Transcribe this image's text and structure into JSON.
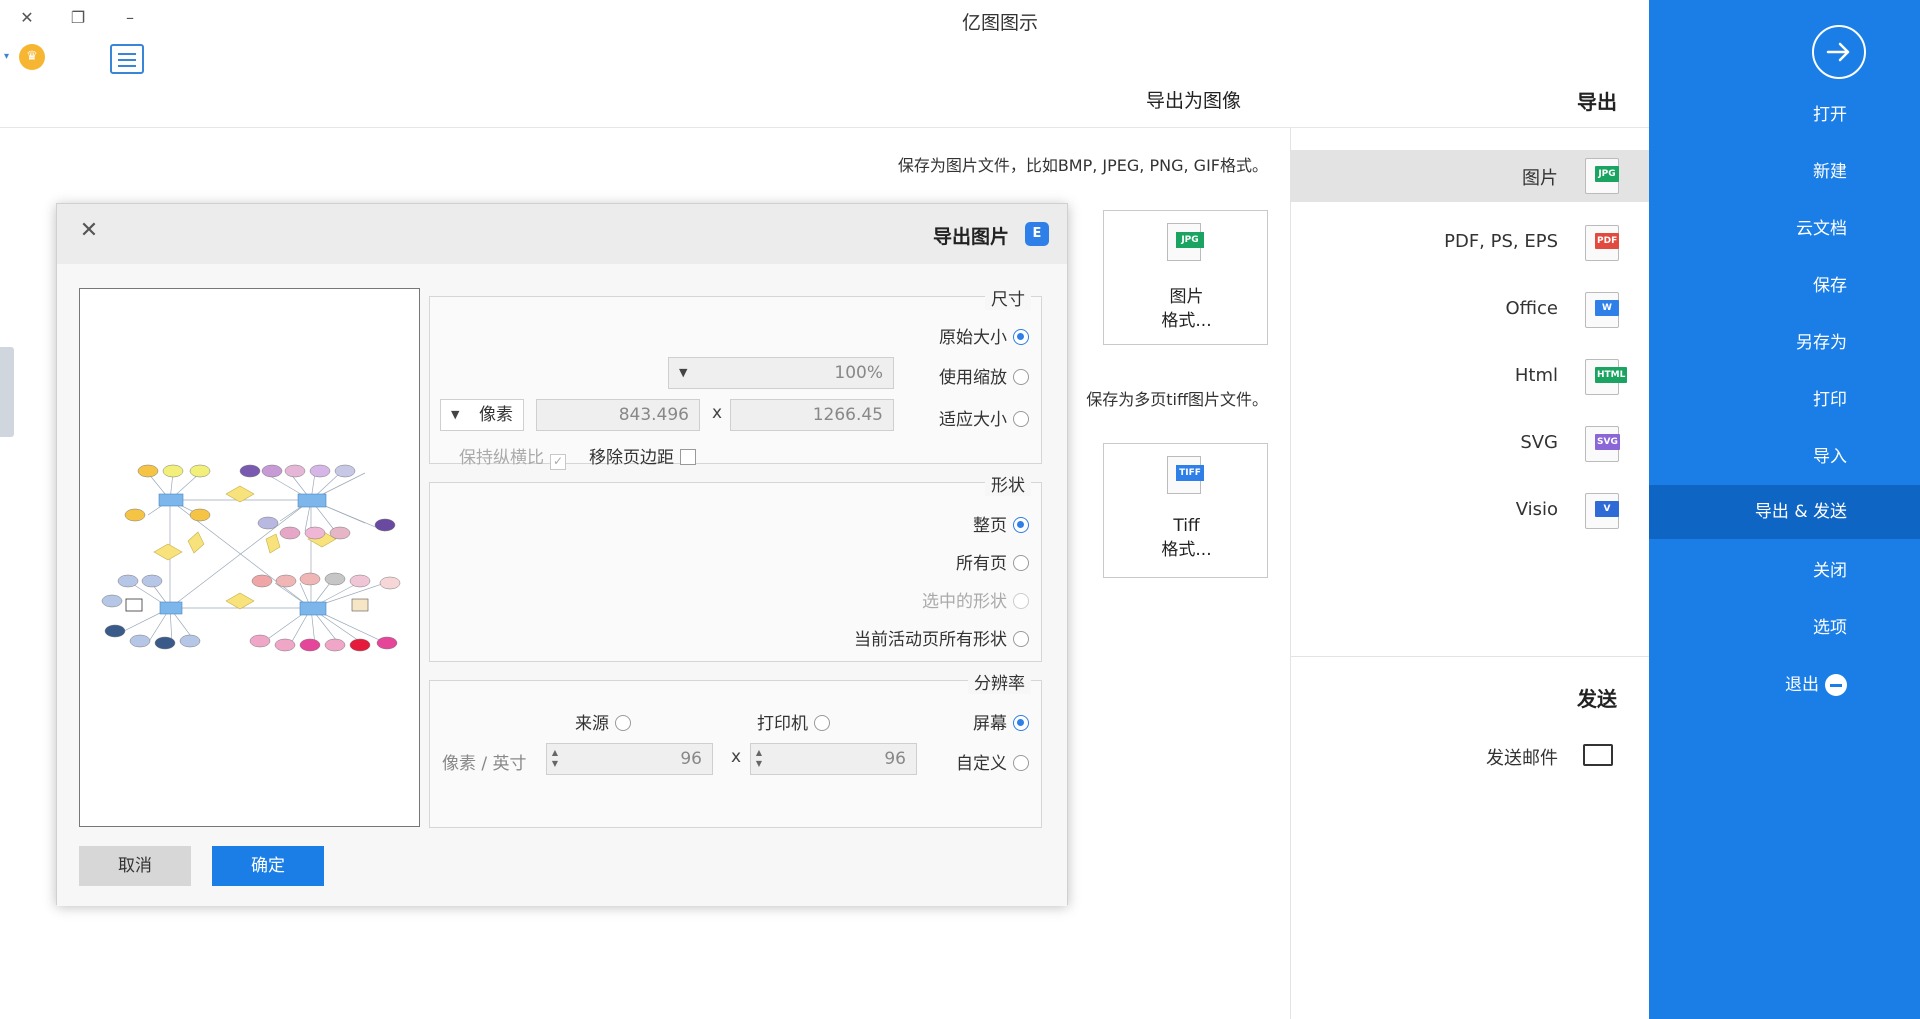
{
  "window": {
    "title": "亿图图示",
    "close_glyph": "✕",
    "restore_glyph": "❐",
    "minimize_glyph": "–"
  },
  "toolbar": {
    "chat_icon": "chat-icon",
    "vip_icon": "vip-crown-icon",
    "vip_arrow": "▾"
  },
  "sidebar": {
    "bg_color": "#1a7ee6",
    "items": [
      {
        "label": "打开"
      },
      {
        "label": "新建"
      },
      {
        "label": "云文档"
      },
      {
        "label": "保存"
      },
      {
        "label": "另存为"
      },
      {
        "label": "打印"
      },
      {
        "label": "导入"
      },
      {
        "label": "导出 & 发送",
        "active": true
      },
      {
        "label": "关闭"
      },
      {
        "label": "选项"
      },
      {
        "label": "退出"
      }
    ]
  },
  "export_panel": {
    "title": "导出",
    "formats": [
      {
        "label": "图片",
        "tag": "JPG",
        "color": "#1aa361",
        "active": true
      },
      {
        "label": "PDF, PS, EPS",
        "tag": "PDF",
        "color": "#e04a3f"
      },
      {
        "label": "Office",
        "tag": "W",
        "color": "#2e7fe8"
      },
      {
        "label": "Html",
        "tag": "HTML",
        "color": "#1aa361"
      },
      {
        "label": "SVG",
        "tag": "SVG",
        "color": "#8a66d6"
      },
      {
        "label": "Visio",
        "tag": "V",
        "color": "#2e6bd6"
      }
    ],
    "send_title": "发送",
    "send_items": [
      {
        "label": "发送邮件"
      }
    ]
  },
  "content": {
    "header": "导出为图像",
    "desc1": "保存为图片文件，比如BMP, JPEG, PNG, GIF格式。",
    "desc2": "保存为多页tiff图片文件。",
    "card1": {
      "line1": "图片",
      "line2": "格式...",
      "tag": "JPG"
    },
    "card2": {
      "line1": "Tiff",
      "line2": "格式...",
      "tag": "TIFF"
    }
  },
  "dialog": {
    "title": "导出图片",
    "logo": "E",
    "close_glyph": "✕",
    "size_group": {
      "title": "尺寸",
      "original": "原始大小",
      "zoom": "使用缩放",
      "zoom_value": "100%",
      "fit": "适应大小",
      "width": "1266.45",
      "x": "x",
      "height": "843.496",
      "unit": "像素",
      "remove_margin": "移除页边距",
      "keep_ratio": "保持纵横比",
      "keep_ratio_check": "✓"
    },
    "shape_group": {
      "title": "形状",
      "whole_page": "整页",
      "all_pages": "所有页",
      "selected": "选中的形状",
      "active_all": "当前活动页所有形状"
    },
    "resolution_group": {
      "title": "分辨率",
      "screen": "屏幕",
      "printer": "打印机",
      "source": "来源",
      "custom": "自定义",
      "dpi_x": "96",
      "x": "x",
      "dpi_y": "96",
      "unit": "像素 / 英寸",
      "spin_up": "▲",
      "spin_down": "▼"
    },
    "ok": "确定",
    "cancel": "取消"
  }
}
